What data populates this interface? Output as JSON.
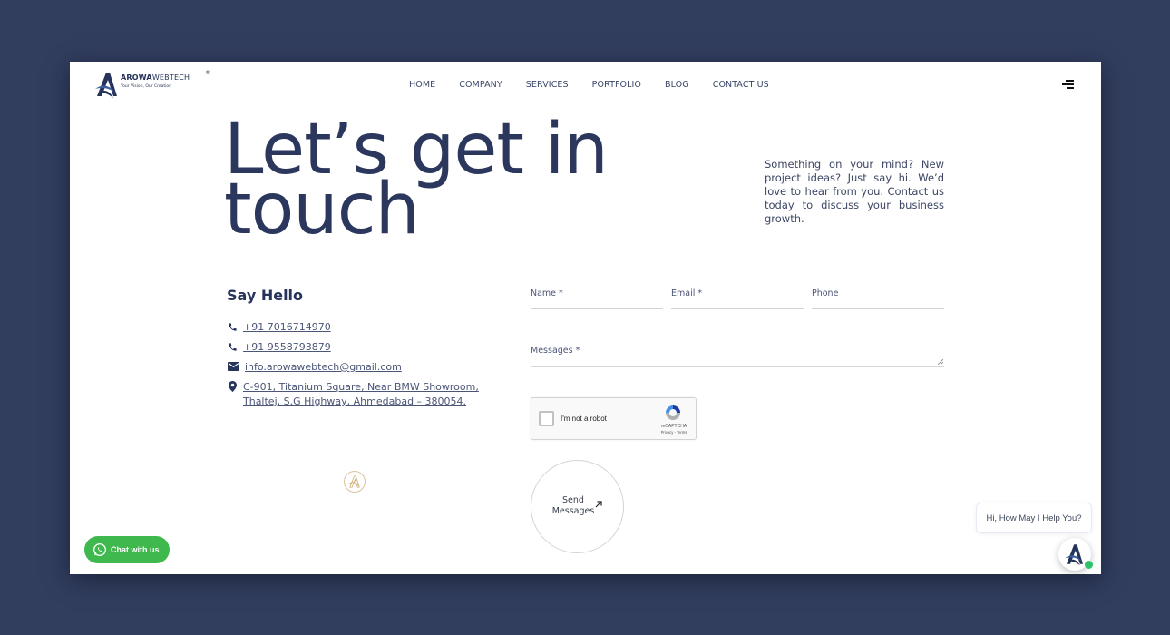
{
  "header": {
    "logo": {
      "name_bold": "AROWA",
      "name_light": "WEBTECH",
      "tagline": "Your Vision, Our Creation",
      "registered": "®"
    },
    "nav": [
      {
        "label": "HOME"
      },
      {
        "label": "COMPANY"
      },
      {
        "label": "SERVICES"
      },
      {
        "label": "PORTFOLIO"
      },
      {
        "label": "BLOG"
      },
      {
        "label": "CONTACT US"
      }
    ],
    "menu_icon": "hamburger-menu-icon"
  },
  "hero": {
    "title_line1": "Let’s get in",
    "title_line2": "touch",
    "description": "Something on your mind? New project ideas? Just say hi. We’d love to hear from you. Contact us today to discuss your business growth."
  },
  "contact": {
    "heading": "Say Hello",
    "items": [
      {
        "icon": "phone-icon",
        "text": "+91 7016714970"
      },
      {
        "icon": "phone-icon",
        "text": "+91 9558793879"
      },
      {
        "icon": "envelope-icon",
        "text": "info.arowawebtech@gmail.com"
      },
      {
        "icon": "map-pin-icon",
        "text": "C-901, Titanium Square, Near BMW Showroom, Thaltej, S.G Highway, Ahmedabad – 380054."
      }
    ]
  },
  "form": {
    "name_label": "Name *",
    "email_label": "Email *",
    "phone_label": "Phone",
    "messages_label": "Messages *",
    "name_value": "",
    "email_value": "",
    "phone_value": "",
    "messages_value": "",
    "recaptcha": {
      "label": "I'm not a robot",
      "brand": "reCAPTCHA",
      "links": "Privacy - Terms",
      "checked": false
    },
    "send_line1": "Send",
    "send_line2": "Messages"
  },
  "whatsapp": {
    "label": "Chat with us"
  },
  "chat": {
    "greeting": "Hi, How May I Help You?",
    "status": "online"
  },
  "colors": {
    "background": "#323e5e",
    "primary_text": "#2b375c",
    "whatsapp_green": "#3fb94d",
    "online_green": "#2ec36b"
  }
}
